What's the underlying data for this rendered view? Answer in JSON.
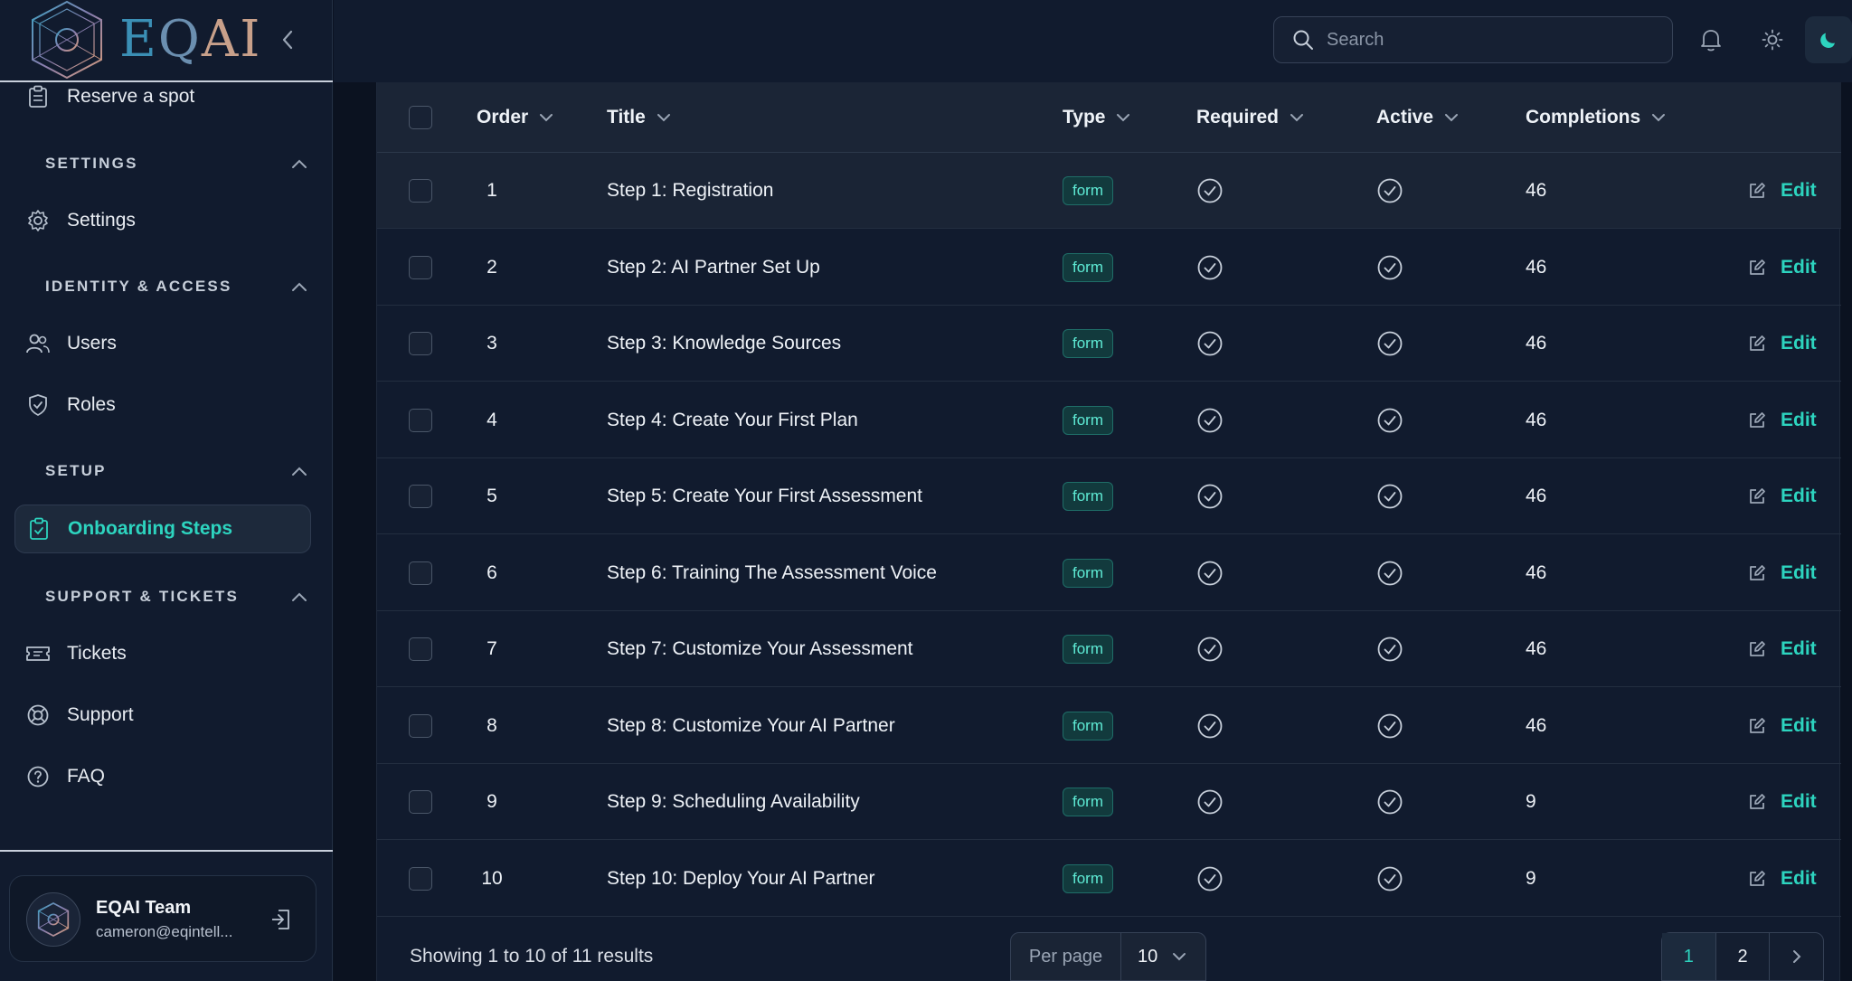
{
  "brand": {
    "name": "EQAI",
    "wm_e": "E",
    "wm_q": "Q",
    "wm_ai": "AI"
  },
  "sidebar": {
    "reserve": "Reserve a spot",
    "sections": {
      "settings": "SETTINGS",
      "identity": "IDENTITY & ACCESS",
      "setup": "SETUP",
      "support": "SUPPORT & TICKETS"
    },
    "items": {
      "settings": "Settings",
      "users": "Users",
      "roles": "Roles",
      "onboarding": "Onboarding Steps",
      "tickets": "Tickets",
      "support": "Support",
      "faq": "FAQ"
    },
    "user": {
      "name": "EQAI Team",
      "email": "cameron@eqintell..."
    }
  },
  "topbar": {
    "search_placeholder": "Search"
  },
  "table": {
    "headers": {
      "order": "Order",
      "title": "Title",
      "type": "Type",
      "required": "Required",
      "active": "Active",
      "completions": "Completions"
    },
    "edit_label": "Edit",
    "rows": [
      {
        "order": "1",
        "title": "Step 1: Registration",
        "type": "form",
        "required": true,
        "active": true,
        "completions": "46"
      },
      {
        "order": "2",
        "title": "Step 2: AI Partner Set Up",
        "type": "form",
        "required": true,
        "active": true,
        "completions": "46"
      },
      {
        "order": "3",
        "title": "Step 3: Knowledge Sources",
        "type": "form",
        "required": true,
        "active": true,
        "completions": "46"
      },
      {
        "order": "4",
        "title": "Step 4: Create Your First Plan",
        "type": "form",
        "required": true,
        "active": true,
        "completions": "46"
      },
      {
        "order": "5",
        "title": "Step 5: Create Your First Assessment",
        "type": "form",
        "required": true,
        "active": true,
        "completions": "46"
      },
      {
        "order": "6",
        "title": "Step 6: Training The Assessment Voice",
        "type": "form",
        "required": true,
        "active": true,
        "completions": "46"
      },
      {
        "order": "7",
        "title": "Step 7: Customize Your Assessment",
        "type": "form",
        "required": true,
        "active": true,
        "completions": "46"
      },
      {
        "order": "8",
        "title": "Step 8: Customize Your AI Partner",
        "type": "form",
        "required": true,
        "active": true,
        "completions": "46"
      },
      {
        "order": "9",
        "title": "Step 9: Scheduling Availability",
        "type": "form",
        "required": true,
        "active": true,
        "completions": "9"
      },
      {
        "order": "10",
        "title": "Step 10: Deploy Your AI Partner",
        "type": "form",
        "required": true,
        "active": true,
        "completions": "9"
      }
    ],
    "footer": {
      "showing": "Showing 1 to 10 of 11 results",
      "per_page_label": "Per page",
      "per_page_value": "10",
      "pages": [
        "1",
        "2"
      ],
      "current_page": "1"
    }
  },
  "colors": {
    "accent": "#2dd4bf",
    "background": "#111b2e"
  }
}
